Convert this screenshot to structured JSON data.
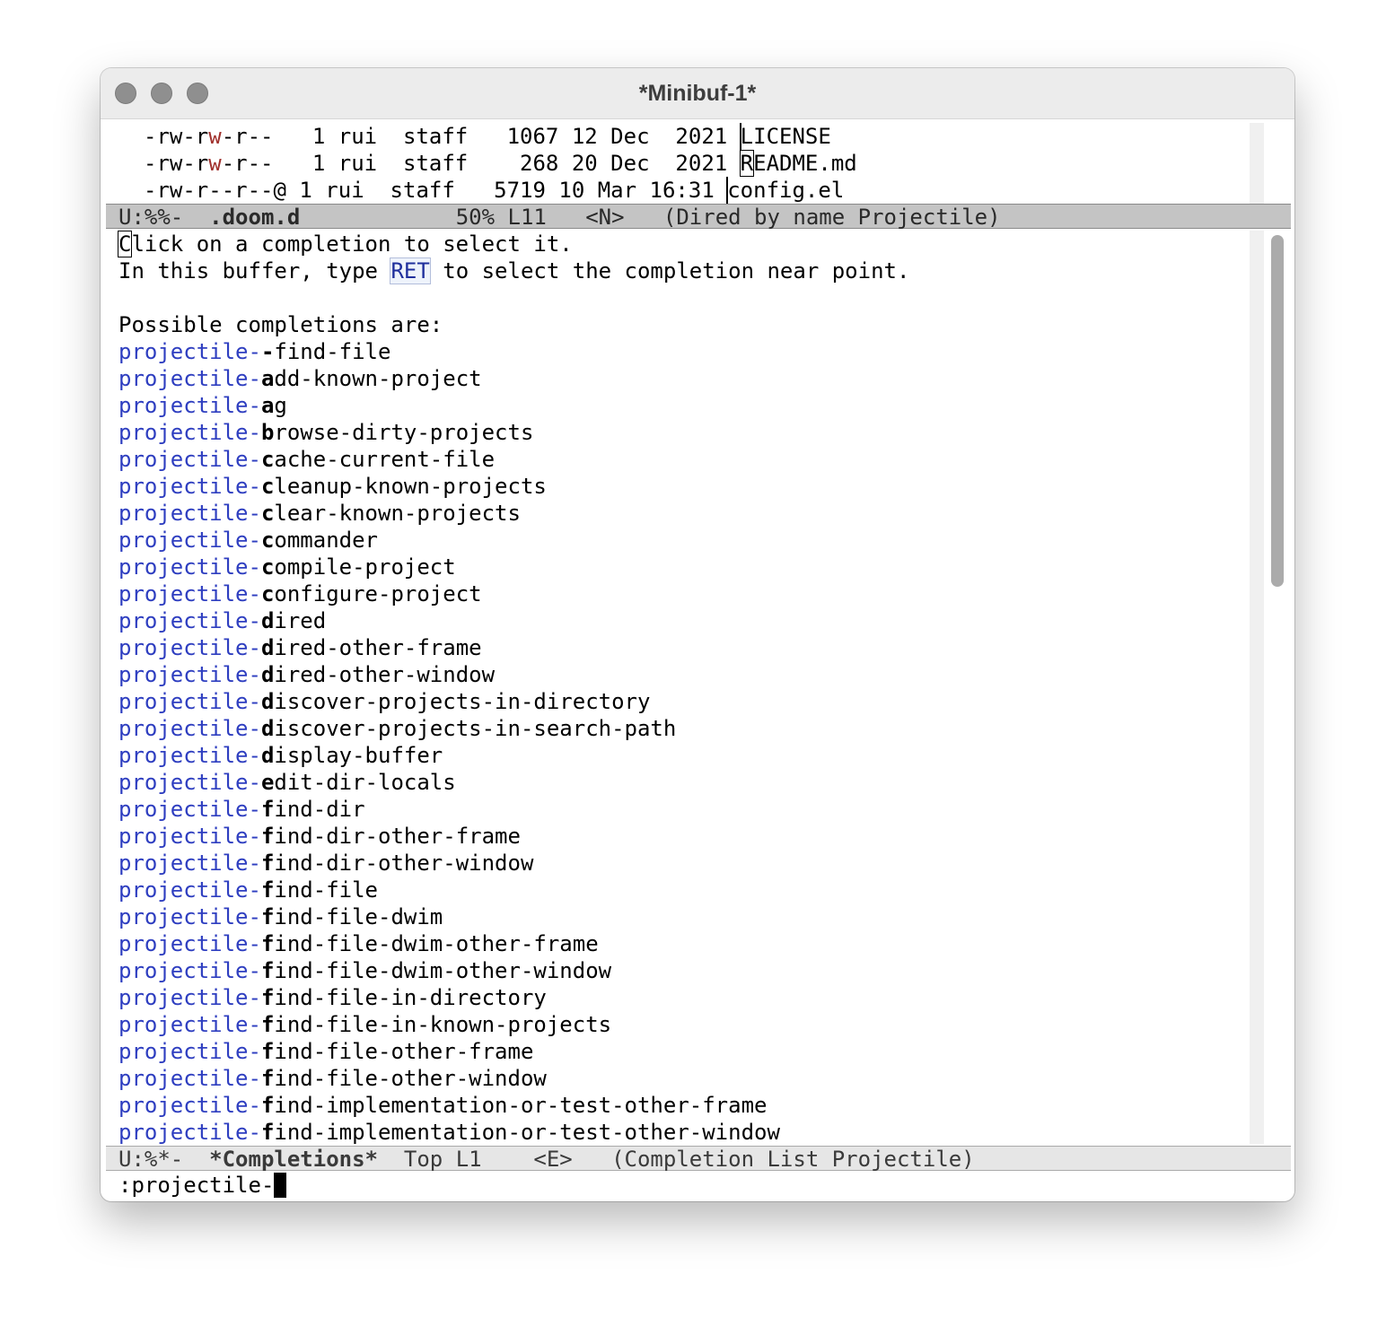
{
  "window": {
    "title": "*Minibuf-1*"
  },
  "dired_lines": [
    {
      "p1": "-rw-r",
      "w": "w",
      "p2": "-r--",
      "rest": "   1 rui  staff   1067 12 Dec  2021 ",
      "name_cursor": "",
      "name": "LICENSE"
    },
    {
      "p1": "-rw-r",
      "w": "w",
      "p2": "-r--",
      "rest": "   1 rui  staff    268 20 Dec  2021 ",
      "name_cursor": "R",
      "name": "EADME.md"
    },
    {
      "p1": "-rw-r--r--@",
      "w": "",
      "p2": "",
      "rest": " 1 rui  staff   5719 10 Mar 16:31 ",
      "name_cursor": "",
      "name": "config.el"
    }
  ],
  "modeline_top": {
    "status": "U:%%-  ",
    "buffer": ".doom.d",
    "info": "            50% L11   <N>   (Dired by name Projectile)"
  },
  "help": {
    "line1_cursor": "C",
    "line1_rest": "lick on a completion to select it.",
    "line2_a": "In this buffer, type ",
    "line2_key": "RET",
    "line2_b": " to select the completion near point.",
    "possible": "Possible completions are:"
  },
  "completions": [
    {
      "prefix": "projectile-",
      "hl": "-",
      "rest": "find-file"
    },
    {
      "prefix": "projectile-",
      "hl": "a",
      "rest": "dd-known-project"
    },
    {
      "prefix": "projectile-",
      "hl": "a",
      "rest": "g"
    },
    {
      "prefix": "projectile-",
      "hl": "b",
      "rest": "rowse-dirty-projects"
    },
    {
      "prefix": "projectile-",
      "hl": "c",
      "rest": "ache-current-file"
    },
    {
      "prefix": "projectile-",
      "hl": "c",
      "rest": "leanup-known-projects"
    },
    {
      "prefix": "projectile-",
      "hl": "c",
      "rest": "lear-known-projects"
    },
    {
      "prefix": "projectile-",
      "hl": "c",
      "rest": "ommander"
    },
    {
      "prefix": "projectile-",
      "hl": "c",
      "rest": "ompile-project"
    },
    {
      "prefix": "projectile-",
      "hl": "c",
      "rest": "onfigure-project"
    },
    {
      "prefix": "projectile-",
      "hl": "d",
      "rest": "ired"
    },
    {
      "prefix": "projectile-",
      "hl": "d",
      "rest": "ired-other-frame"
    },
    {
      "prefix": "projectile-",
      "hl": "d",
      "rest": "ired-other-window"
    },
    {
      "prefix": "projectile-",
      "hl": "d",
      "rest": "iscover-projects-in-directory"
    },
    {
      "prefix": "projectile-",
      "hl": "d",
      "rest": "iscover-projects-in-search-path"
    },
    {
      "prefix": "projectile-",
      "hl": "d",
      "rest": "isplay-buffer"
    },
    {
      "prefix": "projectile-",
      "hl": "e",
      "rest": "dit-dir-locals"
    },
    {
      "prefix": "projectile-",
      "hl": "f",
      "rest": "ind-dir"
    },
    {
      "prefix": "projectile-",
      "hl": "f",
      "rest": "ind-dir-other-frame"
    },
    {
      "prefix": "projectile-",
      "hl": "f",
      "rest": "ind-dir-other-window"
    },
    {
      "prefix": "projectile-",
      "hl": "f",
      "rest": "ind-file"
    },
    {
      "prefix": "projectile-",
      "hl": "f",
      "rest": "ind-file-dwim"
    },
    {
      "prefix": "projectile-",
      "hl": "f",
      "rest": "ind-file-dwim-other-frame"
    },
    {
      "prefix": "projectile-",
      "hl": "f",
      "rest": "ind-file-dwim-other-window"
    },
    {
      "prefix": "projectile-",
      "hl": "f",
      "rest": "ind-file-in-directory"
    },
    {
      "prefix": "projectile-",
      "hl": "f",
      "rest": "ind-file-in-known-projects"
    },
    {
      "prefix": "projectile-",
      "hl": "f",
      "rest": "ind-file-other-frame"
    },
    {
      "prefix": "projectile-",
      "hl": "f",
      "rest": "ind-file-other-window"
    },
    {
      "prefix": "projectile-",
      "hl": "f",
      "rest": "ind-implementation-or-test-other-frame"
    },
    {
      "prefix": "projectile-",
      "hl": "f",
      "rest": "ind-implementation-or-test-other-window"
    }
  ],
  "modeline_bottom": {
    "status": "U:%*-  ",
    "buffer": "*Completions*",
    "info": "  Top L1    <E>   (Completion List Projectile)"
  },
  "minibuffer": {
    "input": ":projectile-"
  },
  "colors": {
    "prefix": "#2e3ec0",
    "writable_perm": "#a0302c",
    "modeline_active": "#c4c4c4",
    "modeline_inactive": "#e6e6e6"
  }
}
